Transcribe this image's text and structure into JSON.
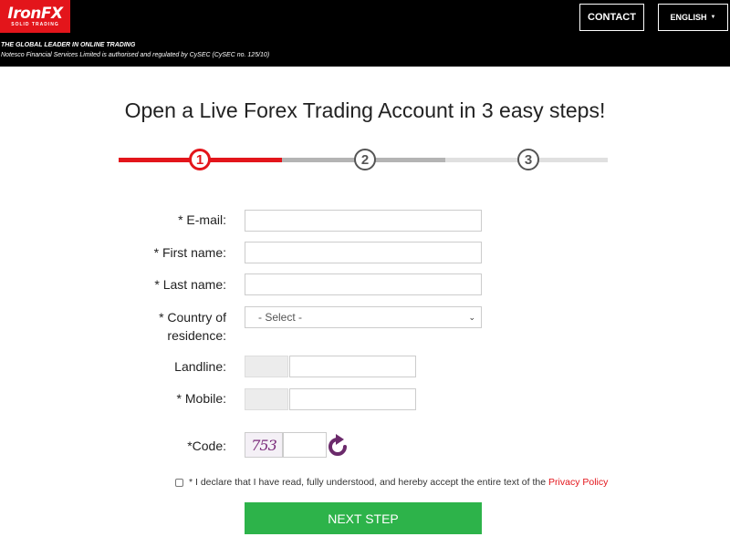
{
  "header": {
    "logo_text": "IronFX",
    "logo_subtext": "SOLID TRADING",
    "tagline": "THE GLOBAL LEADER IN ONLINE TRADING",
    "regulation": "Notesco Financial Services Limited is authorised and regulated by CySEC (CySEC no. 125/10)",
    "contact_label": "CONTACT",
    "language_label": "ENGLISH"
  },
  "page": {
    "title": "Open a Live Forex Trading Account in 3 easy steps!"
  },
  "steps": {
    "current": 1,
    "items": [
      "1",
      "2",
      "3"
    ]
  },
  "form": {
    "email_label": "* E-mail:",
    "email_value": "",
    "first_name_label": "* First name:",
    "first_name_value": "",
    "last_name_label": "* Last name:",
    "last_name_value": "",
    "country_label_line1": "* Country of",
    "country_label_line2": "residence:",
    "country_selected": "- Select -",
    "landline_label": "Landline:",
    "mobile_label": "* Mobile:",
    "code_label": "*Code:",
    "captcha_text": "753",
    "declare_text": "* I declare that I have read, fully understood, and hereby accept the entire text of the",
    "privacy_link": "Privacy Policy",
    "next_label": "NEXT STEP"
  },
  "colors": {
    "brand_red": "#e3151b",
    "button_green": "#2db34a",
    "captcha_purple": "#7a2a7a"
  }
}
